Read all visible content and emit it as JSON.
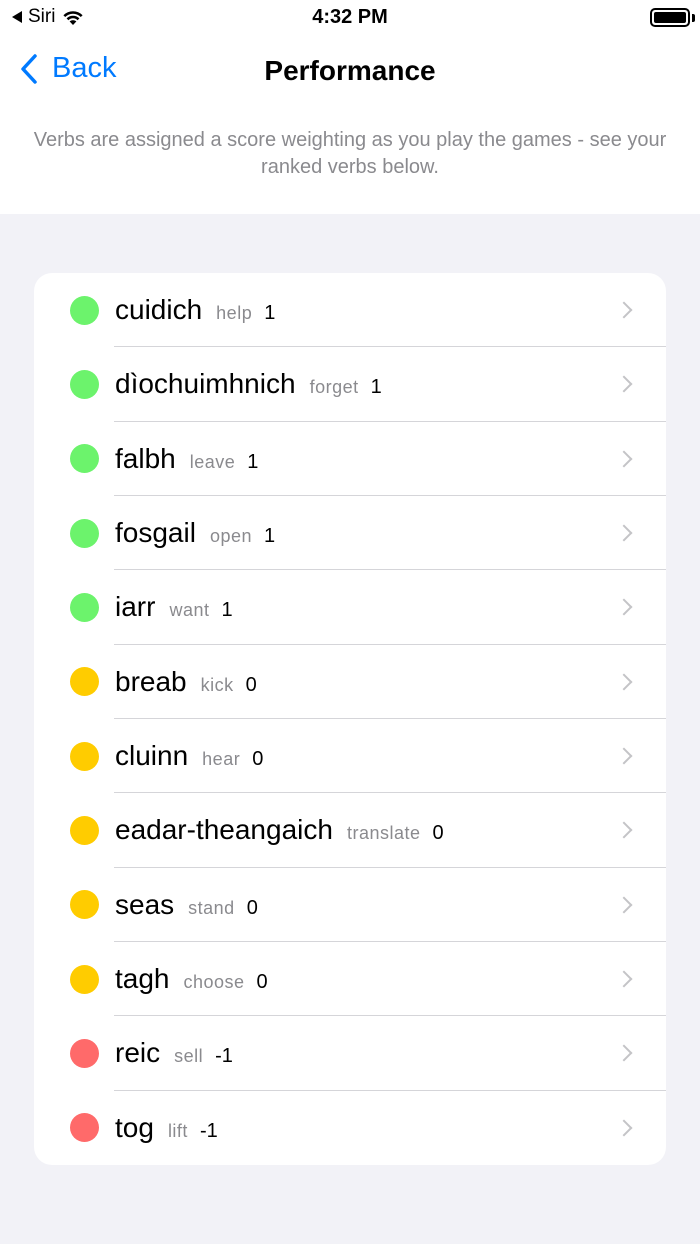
{
  "status_bar": {
    "carrier": "Siri",
    "time": "4:32 PM"
  },
  "nav": {
    "back_label": "Back",
    "title": "Performance"
  },
  "description": "Verbs are assigned a score weighting as you play the games - see your ranked verbs below.",
  "colors": {
    "positive": "#6cf36c",
    "neutral": "#ffcc00",
    "negative": "#ff6a6a",
    "accent": "#007aff"
  },
  "verbs": [
    {
      "verb": "cuidich",
      "translation": "help",
      "score": "1",
      "status": "positive"
    },
    {
      "verb": "dìochuimhnich",
      "translation": "forget",
      "score": "1",
      "status": "positive"
    },
    {
      "verb": "falbh",
      "translation": "leave",
      "score": "1",
      "status": "positive"
    },
    {
      "verb": "fosgail",
      "translation": "open",
      "score": "1",
      "status": "positive"
    },
    {
      "verb": "iarr",
      "translation": "want",
      "score": "1",
      "status": "positive"
    },
    {
      "verb": "breab",
      "translation": "kick",
      "score": "0",
      "status": "neutral"
    },
    {
      "verb": "cluinn",
      "translation": "hear",
      "score": "0",
      "status": "neutral"
    },
    {
      "verb": "eadar-theangaich",
      "translation": "translate",
      "score": "0",
      "status": "neutral"
    },
    {
      "verb": "seas",
      "translation": "stand",
      "score": "0",
      "status": "neutral"
    },
    {
      "verb": "tagh",
      "translation": "choose",
      "score": "0",
      "status": "neutral"
    },
    {
      "verb": "reic",
      "translation": "sell",
      "score": "-1",
      "status": "negative"
    },
    {
      "verb": "tog",
      "translation": "lift",
      "score": "-1",
      "status": "negative"
    }
  ]
}
